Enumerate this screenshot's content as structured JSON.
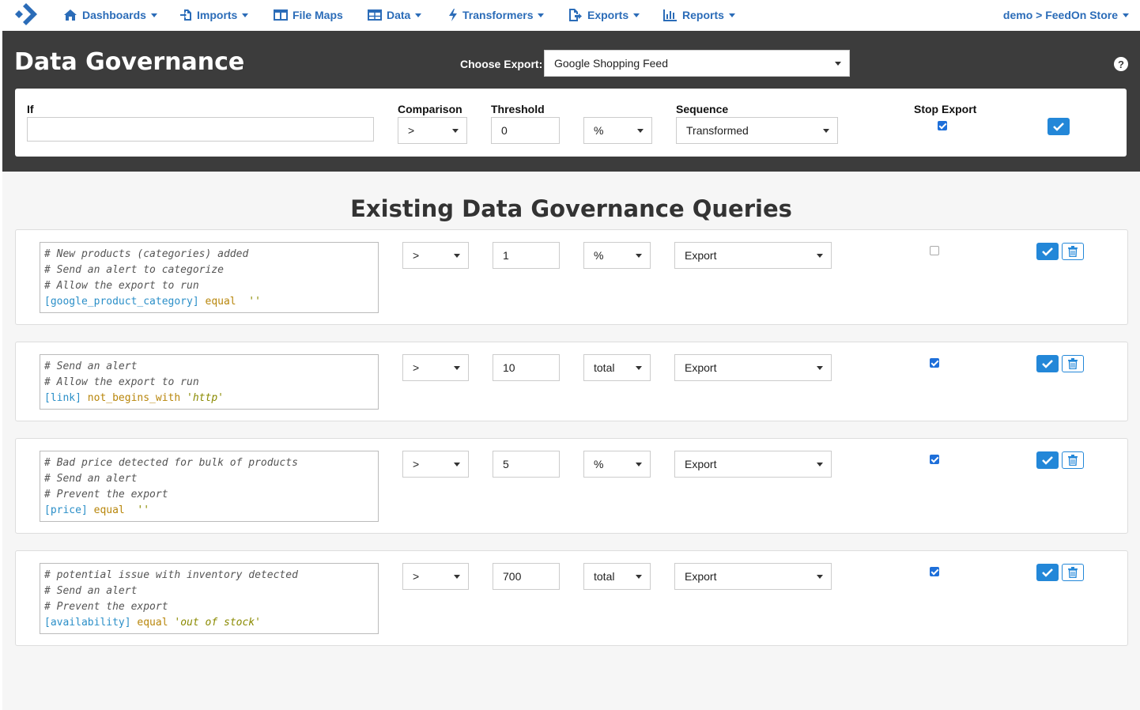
{
  "nav": {
    "items": [
      {
        "label": "Dashboards",
        "icon": "home-icon"
      },
      {
        "label": "Imports",
        "icon": "import-icon"
      },
      {
        "label": "File Maps",
        "icon": "columns-icon"
      },
      {
        "label": "Data",
        "icon": "table-icon"
      },
      {
        "label": "Transformers",
        "icon": "bolt-icon"
      },
      {
        "label": "Exports",
        "icon": "export-icon"
      },
      {
        "label": "Reports",
        "icon": "bar-chart-icon"
      }
    ],
    "user": "demo > FeedOn Store"
  },
  "header": {
    "title": "Data Governance",
    "choose_label": "Choose Export:",
    "choose_value": "Google Shopping Feed",
    "help": "?"
  },
  "form": {
    "if_label": "If",
    "if_value": "",
    "comparison_label": "Comparison",
    "comparison_value": ">",
    "threshold_label": "Threshold",
    "threshold_value": "0",
    "unit_value": "%",
    "sequence_label": "Sequence",
    "sequence_value": "Transformed",
    "stop_label": "Stop Export",
    "stop_checked": true
  },
  "section_title": "Existing Data Governance Queries",
  "queries": [
    {
      "lines": [
        [
          {
            "t": "# New products (categories) added",
            "c": "comment"
          }
        ],
        [
          {
            "t": "# Send an alert to categorize",
            "c": "comment"
          }
        ],
        [
          {
            "t": "# Allow the export to run",
            "c": "comment"
          }
        ],
        [
          {
            "t": "[google_product_category]",
            "c": "field"
          },
          {
            "t": " equal ",
            "c": "op"
          },
          {
            "t": " ''",
            "c": "str"
          }
        ]
      ],
      "comparison": ">",
      "threshold": "1",
      "unit": "%",
      "sequence": "Export",
      "stop": false
    },
    {
      "lines": [
        [
          {
            "t": "# Send an alert",
            "c": "comment"
          }
        ],
        [
          {
            "t": "# Allow the export to run",
            "c": "comment"
          }
        ],
        [
          {
            "t": "[link]",
            "c": "field"
          },
          {
            "t": " not_begins_with ",
            "c": "op"
          },
          {
            "t": "'http'",
            "c": "str"
          }
        ]
      ],
      "comparison": ">",
      "threshold": "10",
      "unit": "total",
      "sequence": "Export",
      "stop": true
    },
    {
      "lines": [
        [
          {
            "t": "# Bad price detected for bulk of products",
            "c": "comment"
          }
        ],
        [
          {
            "t": "# Send an alert",
            "c": "comment"
          }
        ],
        [
          {
            "t": "# Prevent the export",
            "c": "comment"
          }
        ],
        [
          {
            "t": "[price]",
            "c": "field"
          },
          {
            "t": " equal ",
            "c": "op"
          },
          {
            "t": " ''",
            "c": "str"
          }
        ]
      ],
      "comparison": ">",
      "threshold": "5",
      "unit": "%",
      "sequence": "Export",
      "stop": true
    },
    {
      "lines": [
        [
          {
            "t": "# potential issue with inventory detected",
            "c": "comment"
          }
        ],
        [
          {
            "t": "# Send an alert",
            "c": "comment"
          }
        ],
        [
          {
            "t": "# Prevent the export",
            "c": "comment"
          }
        ],
        [
          {
            "t": "[availability]",
            "c": "field"
          },
          {
            "t": " equal ",
            "c": "op"
          },
          {
            "t": "'out of stock'",
            "c": "str"
          }
        ]
      ],
      "comparison": ">",
      "threshold": "700",
      "unit": "total",
      "sequence": "Export",
      "stop": true
    }
  ],
  "colors": {
    "brand": "#2b6cb8",
    "header_bg": "#3c3c3c",
    "primary_button": "#2387d8"
  }
}
